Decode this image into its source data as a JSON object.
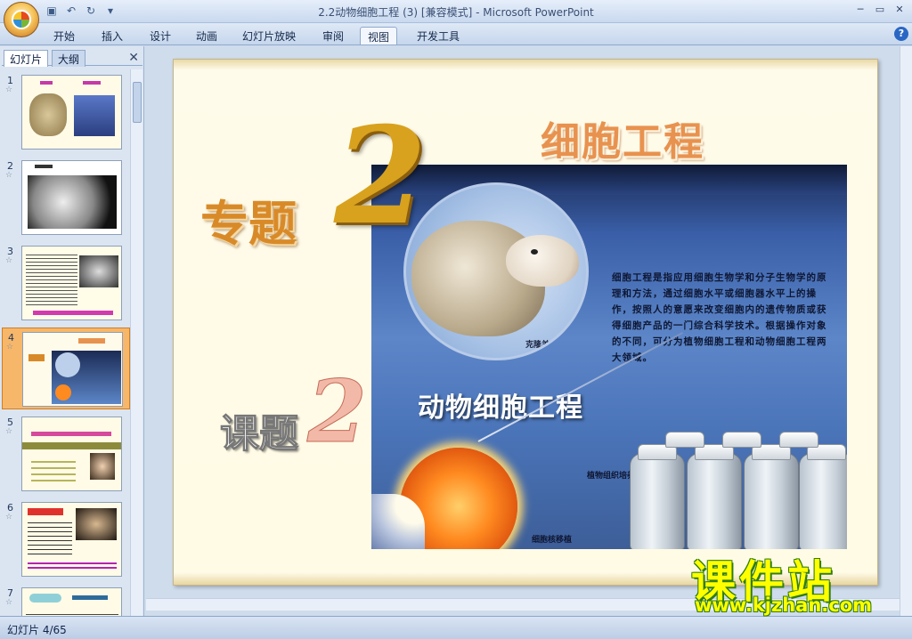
{
  "window": {
    "title": "2.2动物细胞工程 (3) [兼容模式] - Microsoft PowerPoint"
  },
  "ribbon": {
    "tabs": [
      "开始",
      "插入",
      "设计",
      "动画",
      "幻灯片放映",
      "审阅",
      "视图",
      "开发工具"
    ],
    "active_tab": "视图"
  },
  "left_pane": {
    "tabs": [
      "幻灯片",
      "大纲"
    ],
    "active_tab": "幻灯片",
    "slides": [
      {
        "number": "1"
      },
      {
        "number": "2"
      },
      {
        "number": "3"
      },
      {
        "number": "4",
        "selected": true
      },
      {
        "number": "5"
      },
      {
        "number": "6"
      },
      {
        "number": "7"
      }
    ]
  },
  "slide": {
    "title": "细胞工程",
    "topic_label": "专题",
    "topic_number": "2",
    "lesson_label": "课题",
    "lesson_number": "2",
    "photo_heading": "动物细胞工程",
    "sheep_caption": "克隆羊多利",
    "paragraph": "细胞工程是指应用细胞生物学和分子生物学的原理和方法，通过细胞水平或细胞器水平上的操作，按照人的意愿来改变细胞内的遗传物质或获得细胞产品的一门综合科学技术。根据操作对象的不同，可分为植物细胞工程和动物细胞工程两大领域。",
    "label_plant": "植物组织培养",
    "label_nuclear": "细胞核移植"
  },
  "status_bar": {
    "slide_indicator": "幻灯片 4/65"
  },
  "watermark": {
    "line1": "课件站",
    "line2": "www.kjzhan.com"
  },
  "colors": {
    "accent_orange": "#e8924f",
    "gold": "#d8a21e",
    "selection": "#f6b76b"
  }
}
